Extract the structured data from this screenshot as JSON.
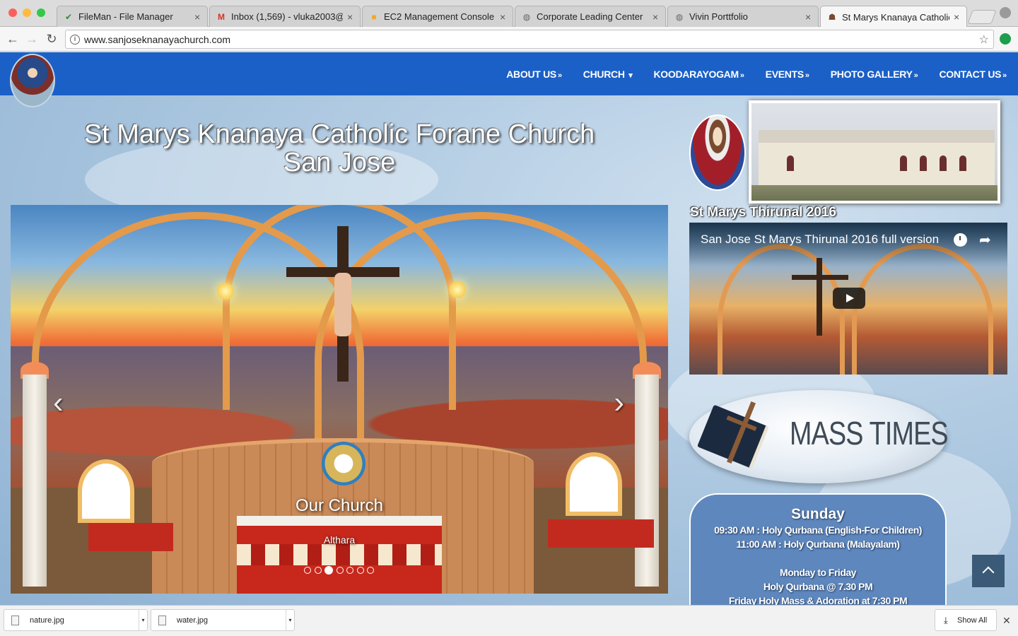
{
  "browser": {
    "tabs": [
      {
        "title": "FileMan - File Manager",
        "icon": "check-icon",
        "icon_glyph": "✔",
        "icon_color": "#2e8b2e"
      },
      {
        "title": "Inbox (1,569) - vluka2003@",
        "icon": "gmail-icon",
        "icon_glyph": "M",
        "icon_color": "#d93025"
      },
      {
        "title": "EC2 Management Console",
        "icon": "aws-icon",
        "icon_glyph": "■",
        "icon_color": "#f0a830"
      },
      {
        "title": "Corporate Leading Center",
        "icon": "globe-icon",
        "icon_glyph": "◍",
        "icon_color": "#666666"
      },
      {
        "title": "Vivin Porttfolio",
        "icon": "globe-icon",
        "icon_glyph": "◍",
        "icon_color": "#666666"
      },
      {
        "title": "St Marys Knanaya Catholic F",
        "icon": "church-favicon-icon",
        "icon_glyph": "☗",
        "icon_color": "#7b4a2e",
        "active": true
      }
    ],
    "tab_close_glyph": "×",
    "nav": {
      "back": "←",
      "forward": "→",
      "reload": "↻"
    },
    "url": "www.sanjoseknanayachurch.com",
    "info_glyph": "i",
    "bookmark_glyph": "☆"
  },
  "site": {
    "nav": [
      {
        "label": "ABOUT US",
        "suffix": "»"
      },
      {
        "label": "CHURCH",
        "suffix": "▾"
      },
      {
        "label": "KOODARAYOGAM",
        "suffix": "»"
      },
      {
        "label": "EVENTS",
        "suffix": "»"
      },
      {
        "label": "PHOTO GALLERY",
        "suffix": "»"
      },
      {
        "label": "CONTACT US",
        "suffix": "»"
      }
    ],
    "title_line1": "St Marys Knanaya Catholic Forane Church",
    "title_line2": "San Jose",
    "carousel": {
      "caption_title": "Our Church",
      "caption_sub": "Althara",
      "prev_glyph": "‹",
      "next_glyph": "›",
      "slide_count": 7,
      "active_index": 2
    },
    "sidebar": {
      "thirunal_title": "St Marys Thirunal 2016",
      "video_title": "San Jose St Marys Thirunal 2016 full version",
      "share_glyph": "➦",
      "mass_banner": "MASS TIMES",
      "schedule": {
        "sunday_title": "Sunday",
        "sunday_lines": [
          "09:30 AM : Holy Qurbana (English-For Children)",
          "11:00 AM : Holy Qurbana (Malayalam)"
        ],
        "weekday_title": "Monday to Friday",
        "weekday_lines": [
          "Holy Qurbana @ 7.30 PM",
          "Friday Holy Mass & Adoration at 7:30 PM"
        ]
      }
    }
  },
  "downloads": {
    "items": [
      {
        "name": "nature.jpg"
      },
      {
        "name": "water.jpg"
      }
    ],
    "caret_glyph": "▾",
    "show_all": "Show All",
    "download_glyph": "⤓",
    "close_glyph": "✕"
  }
}
